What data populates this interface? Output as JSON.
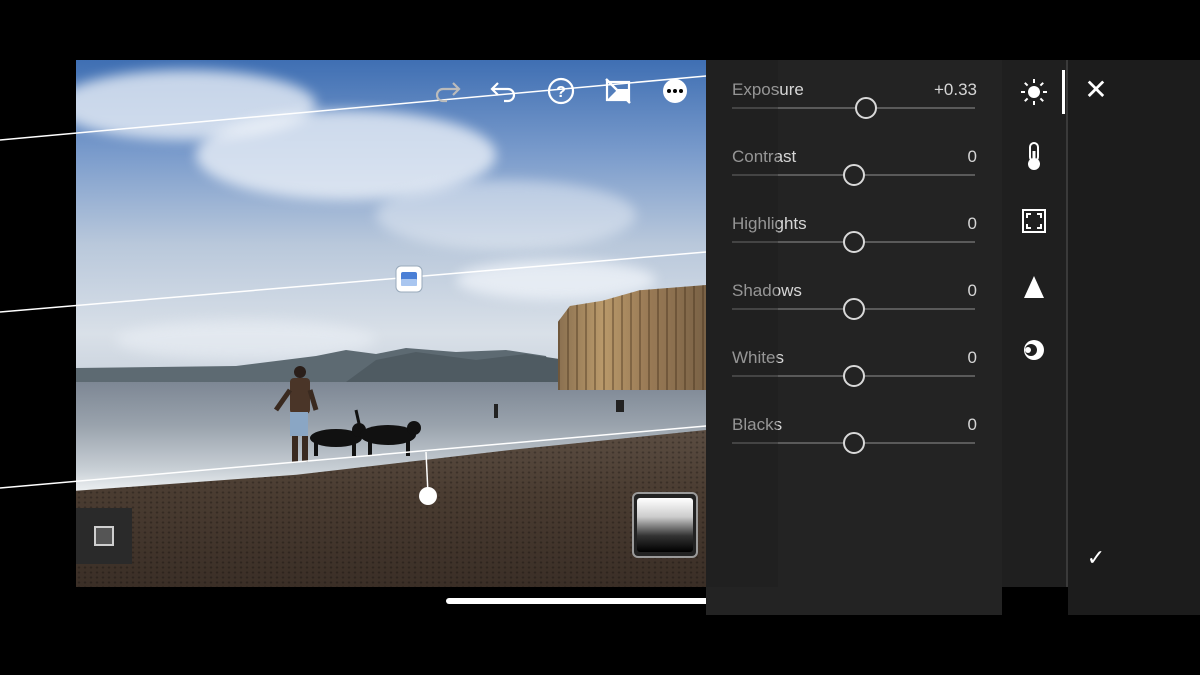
{
  "toolbar": {
    "icons": [
      "redo-icon",
      "undo-icon",
      "help-icon",
      "mask-overlay-off-icon",
      "more-options-icon"
    ]
  },
  "adjustments": [
    {
      "label": "Exposure",
      "value": "+0.33",
      "level": 0.55
    },
    {
      "label": "Contrast",
      "value": "0",
      "level": 0.5
    },
    {
      "label": "Highlights",
      "value": "0",
      "level": 0.5
    },
    {
      "label": "Shadows",
      "value": "0",
      "level": 0.5
    },
    {
      "label": "Whites",
      "value": "0",
      "level": 0.5
    },
    {
      "label": "Blacks",
      "value": "0",
      "level": 0.5
    }
  ],
  "tools": [
    "light-icon",
    "color-temperature-icon",
    "effects-icon",
    "detail-icon",
    "optics-icon"
  ],
  "actions": {
    "close": "✕",
    "confirm": "✓"
  },
  "colors": {
    "panel": "#232323",
    "accent": "#ffffff"
  }
}
